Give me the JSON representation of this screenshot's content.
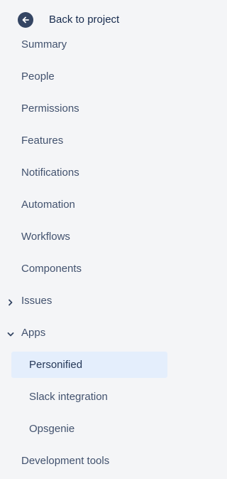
{
  "back": {
    "label": "Back to project",
    "icon": "arrow-left-circle-icon"
  },
  "nav": {
    "items": [
      {
        "label": "Summary"
      },
      {
        "label": "People"
      },
      {
        "label": "Permissions"
      },
      {
        "label": "Features"
      },
      {
        "label": "Notifications"
      },
      {
        "label": "Automation"
      },
      {
        "label": "Workflows"
      },
      {
        "label": "Components"
      },
      {
        "label": "Issues",
        "expanded": false
      },
      {
        "label": "Apps",
        "expanded": true
      },
      {
        "label": "Personified",
        "selected": true
      },
      {
        "label": "Slack integration"
      },
      {
        "label": "Opsgenie"
      },
      {
        "label": "Development tools"
      }
    ]
  },
  "colors": {
    "sidebar_background": "#f4f5f7",
    "selected_background": "#e4eefc",
    "text": "#42526e",
    "icon": "#344563"
  }
}
